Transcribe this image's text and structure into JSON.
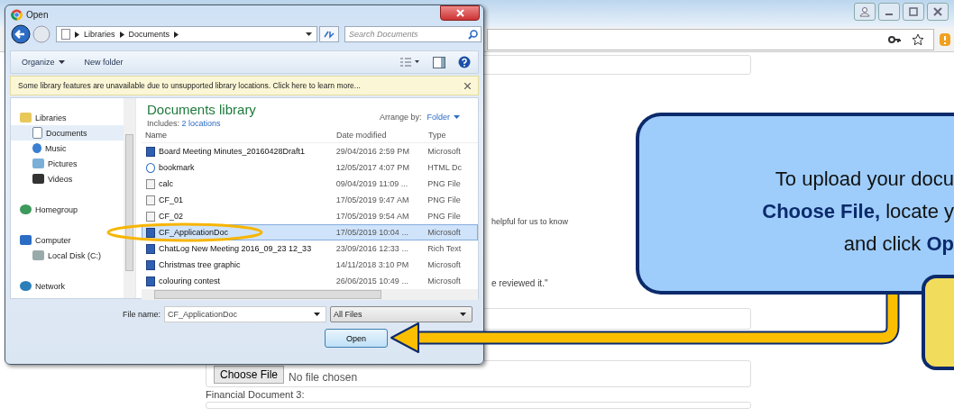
{
  "page": {
    "hint_fragment": "helpful for us to know",
    "quote_fragment": "e reviewed it.\"",
    "choose_file_button": "Choose File",
    "no_file_text": "No file chosen",
    "next_label": "Financial Document 3:"
  },
  "dialog": {
    "title": "Open",
    "breadcrumb": [
      "Libraries",
      "Documents"
    ],
    "search": {
      "placeholder": "Search Documents"
    },
    "toolbar": [
      {
        "label": "Organize",
        "kind": "menu"
      },
      {
        "label": "New folder",
        "kind": "button"
      }
    ],
    "info_bar": "Some library features are unavailable due to unsupported library locations. Click here to learn more...",
    "sidebar": [
      {
        "label": "Libraries",
        "kind": "library",
        "selected": false,
        "children": [
          {
            "label": "Documents",
            "kind": "documents",
            "selected": true
          },
          {
            "label": "Music",
            "kind": "music",
            "selected": false
          },
          {
            "label": "Pictures",
            "kind": "pictures",
            "selected": false
          },
          {
            "label": "Videos",
            "kind": "videos",
            "selected": false
          }
        ]
      },
      {
        "label": "Homegroup",
        "kind": "homegroup",
        "selected": false
      },
      {
        "label": "Computer",
        "kind": "computer",
        "selected": false,
        "children": [
          {
            "label": "Local Disk (C:)",
            "kind": "disk",
            "selected": false
          }
        ]
      },
      {
        "label": "Network",
        "kind": "network",
        "selected": false
      }
    ],
    "library": {
      "title": "Documents library",
      "includes_label": "Includes:",
      "includes_link": "2 locations",
      "arrange_label": "Arrange by:",
      "arrange_value": "Folder"
    },
    "columns": [
      "Name",
      "Date modified",
      "Type"
    ],
    "files": [
      {
        "name": "Board Meeting Minutes_20160428Draft1",
        "date": "29/04/2016 2:59 PM",
        "type": "Microsoft",
        "kind": "word",
        "selected": false
      },
      {
        "name": "bookmark",
        "date": "12/05/2017 4:07 PM",
        "type": "HTML Dc",
        "kind": "html",
        "selected": false
      },
      {
        "name": "calc",
        "date": "09/04/2019 11:09 ...",
        "type": "PNG File",
        "kind": "image",
        "selected": false
      },
      {
        "name": "CF_01",
        "date": "17/05/2019 9:47 AM",
        "type": "PNG File",
        "kind": "image",
        "selected": false
      },
      {
        "name": "CF_02",
        "date": "17/05/2019 9:54 AM",
        "type": "PNG File",
        "kind": "image",
        "selected": false
      },
      {
        "name": "CF_ApplicationDoc",
        "date": "17/05/2019 10:04 ...",
        "type": "Microsoft",
        "kind": "word",
        "selected": true
      },
      {
        "name": "ChatLog New Meeting 2016_09_23 12_33",
        "date": "23/09/2016 12:33 ...",
        "type": "Rich Text",
        "kind": "word",
        "selected": false
      },
      {
        "name": "Christmas tree graphic",
        "date": "14/11/2018 3:10 PM",
        "type": "Microsoft",
        "kind": "word",
        "selected": false
      },
      {
        "name": "colouring contest",
        "date": "26/06/2015 10:49 ...",
        "type": "Microsoft",
        "kind": "word",
        "selected": false
      }
    ],
    "file_name": {
      "label": "File name:",
      "value": "CF_ApplicationDoc"
    },
    "file_type": "All Files",
    "open_button": "Open"
  },
  "callout": {
    "lines": [
      "To upload your docu",
      "**Choose File,** locate y",
      "and click **Op**"
    ]
  }
}
